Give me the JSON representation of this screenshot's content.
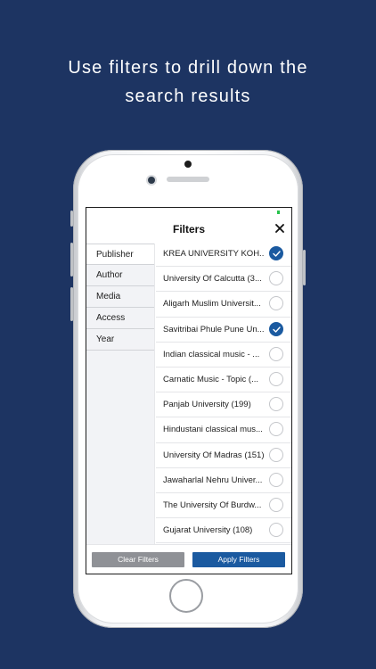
{
  "headline": [
    "Use filters to drill down the",
    "search results"
  ],
  "screen": {
    "title": "Filters",
    "sidebar": [
      "Publisher",
      "Author",
      "Media",
      "Access",
      "Year"
    ],
    "rows": [
      {
        "label": "KREA UNIVERSITY KOH...",
        "checked": true
      },
      {
        "label": "University Of Calcutta (3...",
        "checked": false
      },
      {
        "label": "Aligarh Muslim Universit...",
        "checked": false
      },
      {
        "label": "Savitribai Phule Pune Un...",
        "checked": true
      },
      {
        "label": "Indian classical music - ...",
        "checked": false
      },
      {
        "label": "Carnatic Music - Topic (...",
        "checked": false
      },
      {
        "label": "Panjab University (199)",
        "checked": false
      },
      {
        "label": "Hindustani classical mus...",
        "checked": false
      },
      {
        "label": "University Of Madras (151)",
        "checked": false
      },
      {
        "label": "Jawaharlal Nehru Univer...",
        "checked": false
      },
      {
        "label": "The University Of Burdw...",
        "checked": false
      },
      {
        "label": "Gujarat University (108)",
        "checked": false
      }
    ],
    "clear_label": "Clear Filters",
    "apply_label": "Apply Filters"
  },
  "colors": {
    "background": "#1d3462",
    "accent": "#1b5aa0",
    "clear": "#8f9196"
  }
}
